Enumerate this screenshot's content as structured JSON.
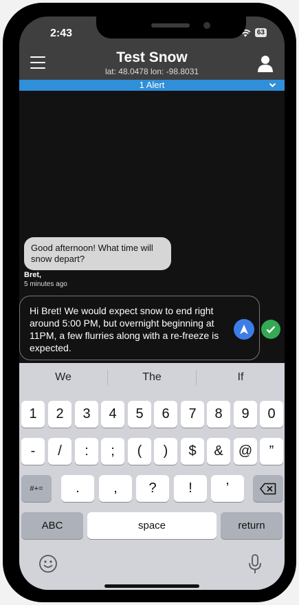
{
  "status": {
    "time": "2:43",
    "battery": "63"
  },
  "header": {
    "title": "Test Snow",
    "coords": "lat: 48.0478 lon: -98.8031"
  },
  "alert": {
    "label": "1 Alert"
  },
  "messages": {
    "incoming": {
      "text": "Good afternoon! What time will snow depart?",
      "sender": "Bret,",
      "time": "5 minutes ago"
    },
    "draft": "Hi Bret! We would expect snow to end right around 5:00 PM, but overnight beginning at 11PM, a few flurries along with a re-freeze is expected."
  },
  "keyboard": {
    "suggestions": [
      "We",
      "The",
      "If"
    ],
    "row1": [
      "1",
      "2",
      "3",
      "4",
      "5",
      "6",
      "7",
      "8",
      "9",
      "0"
    ],
    "row2": [
      "-",
      "/",
      ":",
      ";",
      "(",
      ")",
      "$",
      "&",
      "@",
      "”"
    ],
    "row3_left": "#+=",
    "row3": [
      ".",
      ",",
      "?",
      "!",
      "’"
    ],
    "abc": "ABC",
    "space": "space",
    "return": "return"
  },
  "colors": {
    "alert_bar": "#2f8fd8",
    "send_button": "#3d7de6",
    "check_button": "#34a853",
    "header": "#3f3f3f"
  }
}
